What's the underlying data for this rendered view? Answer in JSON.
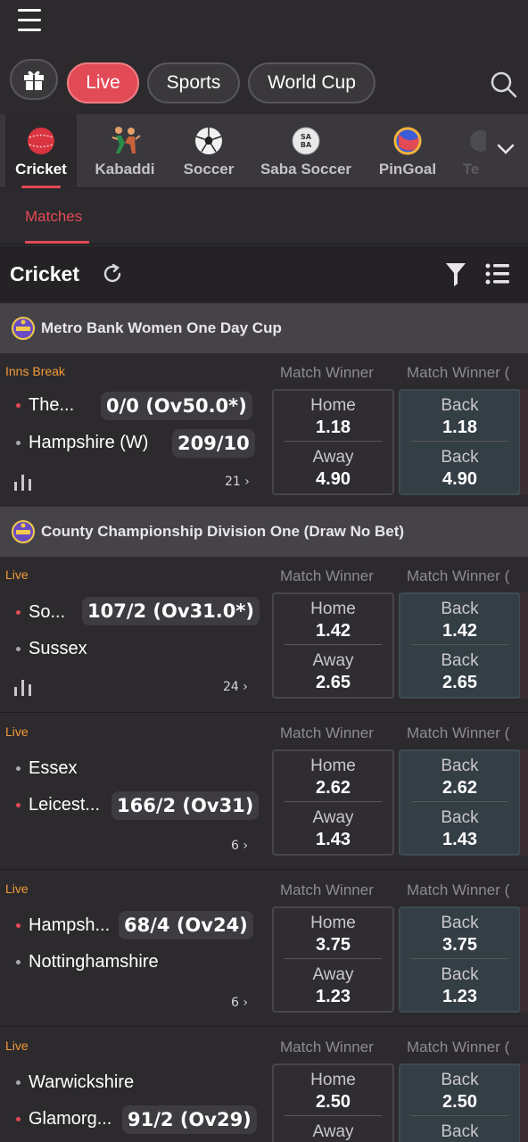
{
  "nav": {
    "pills": [
      {
        "label": "Live"
      },
      {
        "label": "Sports"
      },
      {
        "label": "World Cup"
      }
    ]
  },
  "sports_tabs": [
    "Cricket",
    "Kabaddi",
    "Soccer",
    "Saba Soccer",
    "PinGoal",
    "Te"
  ],
  "sub_tab": "Matches",
  "section_title": "Cricket",
  "leagues": [
    {
      "name": "Metro Bank Women One Day Cup"
    },
    {
      "name": "County Championship Division One (Draw No Bet)"
    }
  ],
  "market_headers": {
    "a": "Match Winner",
    "b": "Match Winner ("
  },
  "odds_labels": {
    "home": "Home",
    "away": "Away",
    "back": "Back"
  },
  "matches": [
    {
      "status": "Inns Break",
      "team1": "The...",
      "team2": "Hampshire (W)",
      "score1": "0/0 (Ov50.0*)",
      "score2": "209/10",
      "count": "21",
      "home": "1.18",
      "away": "4.90"
    },
    {
      "status": "Live",
      "team1": "So...",
      "team2": "Sussex",
      "score1": "107/2 (Ov31.0*)",
      "count": "24",
      "home": "1.42",
      "away": "2.65"
    },
    {
      "status": "Live",
      "team1": "Essex",
      "team2": "Leicest...",
      "score2": "166/2 (Ov31)",
      "count": "6",
      "home": "2.62",
      "away": "1.43"
    },
    {
      "status": "Live",
      "team1": "Hampsh...",
      "team2": "Nottinghamshire",
      "score1": "68/4 (Ov24)",
      "count": "6",
      "home": "3.75",
      "away": "1.23"
    },
    {
      "status": "Live",
      "team1": "Warwickshire",
      "team2": "Glamorg...",
      "score2": "91/2 (Ov29)",
      "home": "2.50",
      "away": ""
    }
  ]
}
